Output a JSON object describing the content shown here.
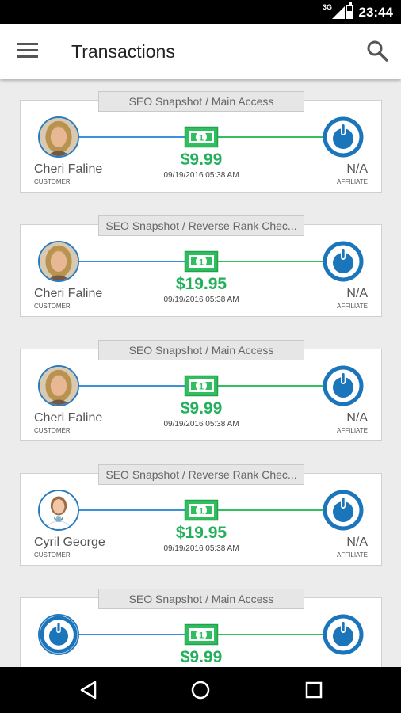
{
  "status_bar": {
    "network": "3G",
    "time": "23:44"
  },
  "app_bar": {
    "title": "Transactions"
  },
  "transactions": [
    {
      "product": "SEO Snapshot / Main Access",
      "customer_name": "Cheri Faline",
      "customer_role": "CUSTOMER",
      "customer_avatar": "woman-blonde-photo",
      "amount": "$9.99",
      "date": "09/19/2016 05:38 AM",
      "affiliate_name": "N/A",
      "affiliate_role": "AFFILIATE"
    },
    {
      "product": "SEO Snapshot / Reverse Rank Chec...",
      "customer_name": "Cheri Faline",
      "customer_role": "CUSTOMER",
      "customer_avatar": "woman-blonde-photo",
      "amount": "$19.95",
      "date": "09/19/2016 05:38 AM",
      "affiliate_name": "N/A",
      "affiliate_role": "AFFILIATE"
    },
    {
      "product": "SEO Snapshot / Main Access",
      "customer_name": "Cheri Faline",
      "customer_role": "CUSTOMER",
      "customer_avatar": "woman-blonde-photo",
      "amount": "$9.99",
      "date": "09/19/2016 05:38 AM",
      "affiliate_name": "N/A",
      "affiliate_role": "AFFILIATE"
    },
    {
      "product": "SEO Snapshot / Reverse Rank Chec...",
      "customer_name": "Cyril George",
      "customer_role": "CUSTOMER",
      "customer_avatar": "doctor-photo",
      "amount": "$19.95",
      "date": "09/19/2016 05:38 AM",
      "affiliate_name": "N/A",
      "affiliate_role": "AFFILIATE"
    },
    {
      "product": "SEO Snapshot / Main Access",
      "customer_name": "",
      "customer_role": "",
      "customer_avatar": "default-user-icon",
      "amount": "$9.99",
      "date": "",
      "affiliate_name": "",
      "affiliate_role": ""
    }
  ],
  "colors": {
    "blue_line": "#3d8fd6",
    "green": "#22b05a",
    "icon_blue": "#1b75bb"
  },
  "nav_bar": {
    "icons": [
      "back-icon",
      "home-icon",
      "recents-icon"
    ]
  }
}
